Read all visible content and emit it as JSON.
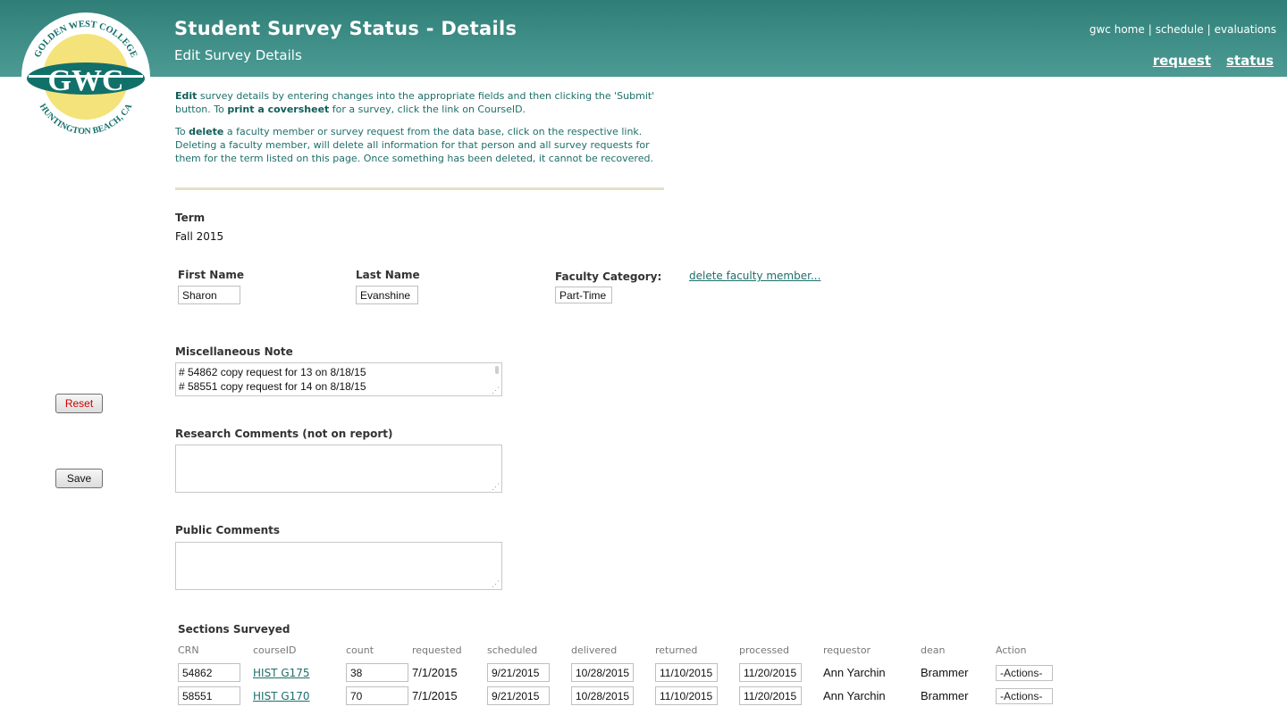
{
  "header": {
    "title": "Student Survey Status - Details",
    "subtitle": "Edit Survey Details",
    "top_links": [
      "gwc home",
      "schedule",
      "evaluations"
    ],
    "nav_links": [
      "request",
      "status"
    ]
  },
  "logo": {
    "arc_top": "GOLDEN WEST COLLEGE",
    "arc_bottom": "HUNTINGTON BEACH, CA",
    "center": "GWC"
  },
  "intro": {
    "p1": {
      "b1": "Edit",
      "t1": " survey details by entering changes into the appropriate fields and then clicking the 'Submit' button. To ",
      "b2": "print a coversheet",
      "t2": " for a survey, click the link on CourseID."
    },
    "p2": {
      "t0": "To ",
      "b1": "delete",
      "t1": " a faculty member or survey request from the data base, click on the respective link. Deleting a faculty member, will delete all information for that person and all survey requests for them for the term listed on this page. Once something has been deleted, it cannot be recovered."
    }
  },
  "form": {
    "term_label": "Term",
    "term_value": "Fall 2015",
    "first_name_label": "First Name",
    "first_name": "Sharon",
    "last_name_label": "Last Name",
    "last_name": "Evanshine",
    "faculty_category_label": "Faculty Category:",
    "faculty_category": "Part-Time",
    "delete_faculty_link": "delete faculty member...",
    "misc_note_label": "Miscellaneous Note",
    "misc_note_lines": [
      "# 54862 copy request  for 13 on 8/18/15",
      "# 58551 copy request  for 14 on 8/18/15"
    ],
    "research_label": "Research Comments (not on report)",
    "research_value": "",
    "public_label": "Public Comments",
    "public_value": ""
  },
  "buttons": {
    "reset": "Reset",
    "save": "Save"
  },
  "colors": {
    "header": "#3f8f88",
    "link": "#1d6f6a",
    "reset_text": "#cc0000",
    "rule": "#e4e0c8"
  },
  "sections": {
    "title": "Sections Surveyed",
    "columns": [
      "CRN",
      "courseID",
      "count",
      "requested",
      "scheduled",
      "delivered",
      "returned",
      "processed",
      "requestor",
      "dean",
      "Action"
    ],
    "rows": [
      {
        "crn": "54862",
        "course": "HIST G175",
        "count": "38",
        "requested": "7/1/2015",
        "scheduled": "9/21/2015",
        "delivered": "10/28/2015",
        "returned": "11/10/2015",
        "processed": "11/20/2015",
        "requestor": "Ann Yarchin",
        "dean": "Brammer",
        "action": "-Actions-"
      },
      {
        "crn": "58551",
        "course": "HIST G170",
        "count": "70",
        "requested": "7/1/2015",
        "scheduled": "9/21/2015",
        "delivered": "10/28/2015",
        "returned": "11/10/2015",
        "processed": "11/20/2015",
        "requestor": "Ann Yarchin",
        "dean": "Brammer",
        "action": "-Actions-"
      }
    ]
  }
}
